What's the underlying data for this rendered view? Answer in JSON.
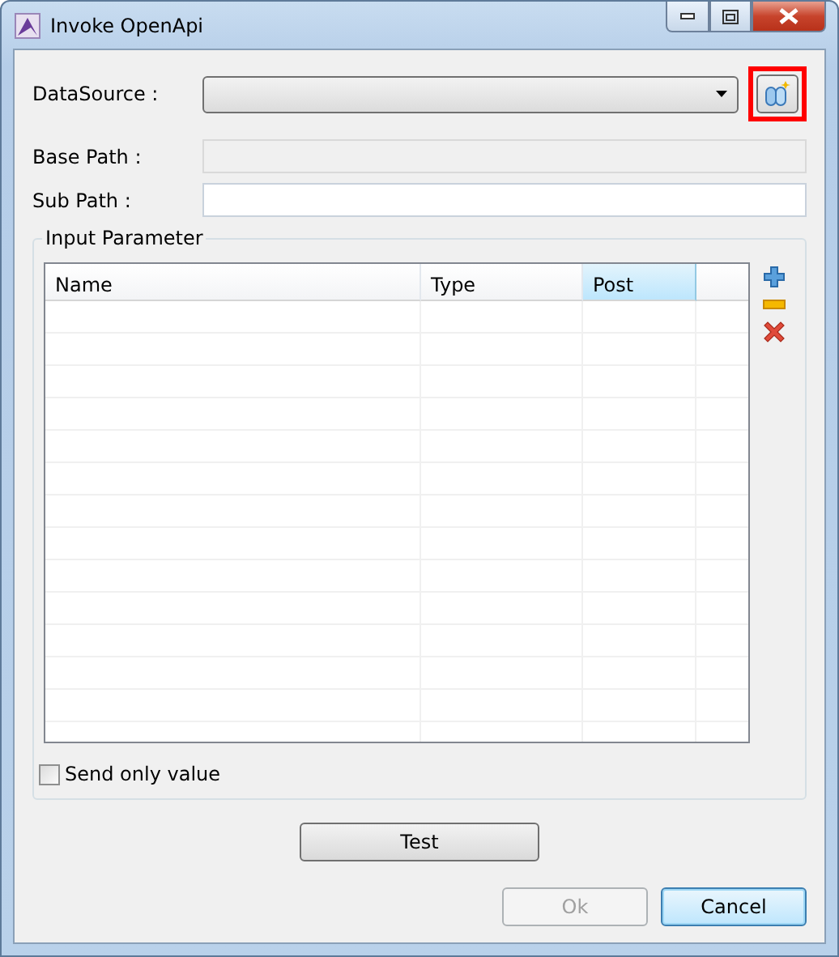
{
  "window": {
    "title": "Invoke OpenApi"
  },
  "datasource": {
    "label": "DataSource :",
    "button_highlighted": true
  },
  "base_path": {
    "label": "Base Path :",
    "disabled": true
  },
  "sub_path": {
    "label": "Sub Path :",
    "disabled": false
  },
  "input_parameter": {
    "title": "Input Parameter",
    "columns": [
      {
        "label": "Name",
        "selected": false
      },
      {
        "label": "Type",
        "selected": false
      },
      {
        "label": "Post",
        "selected": true
      }
    ],
    "actions": [
      {
        "kind": "add"
      },
      {
        "kind": "remove"
      },
      {
        "kind": "delete"
      }
    ],
    "send_only_value": {
      "label": "Send only value",
      "checked": false
    }
  },
  "test_button": {
    "label": "Test"
  },
  "buttons": [
    {
      "label": "Ok",
      "disabled": true,
      "focused": false
    },
    {
      "label": "Cancel",
      "disabled": false,
      "focused": true
    }
  ]
}
